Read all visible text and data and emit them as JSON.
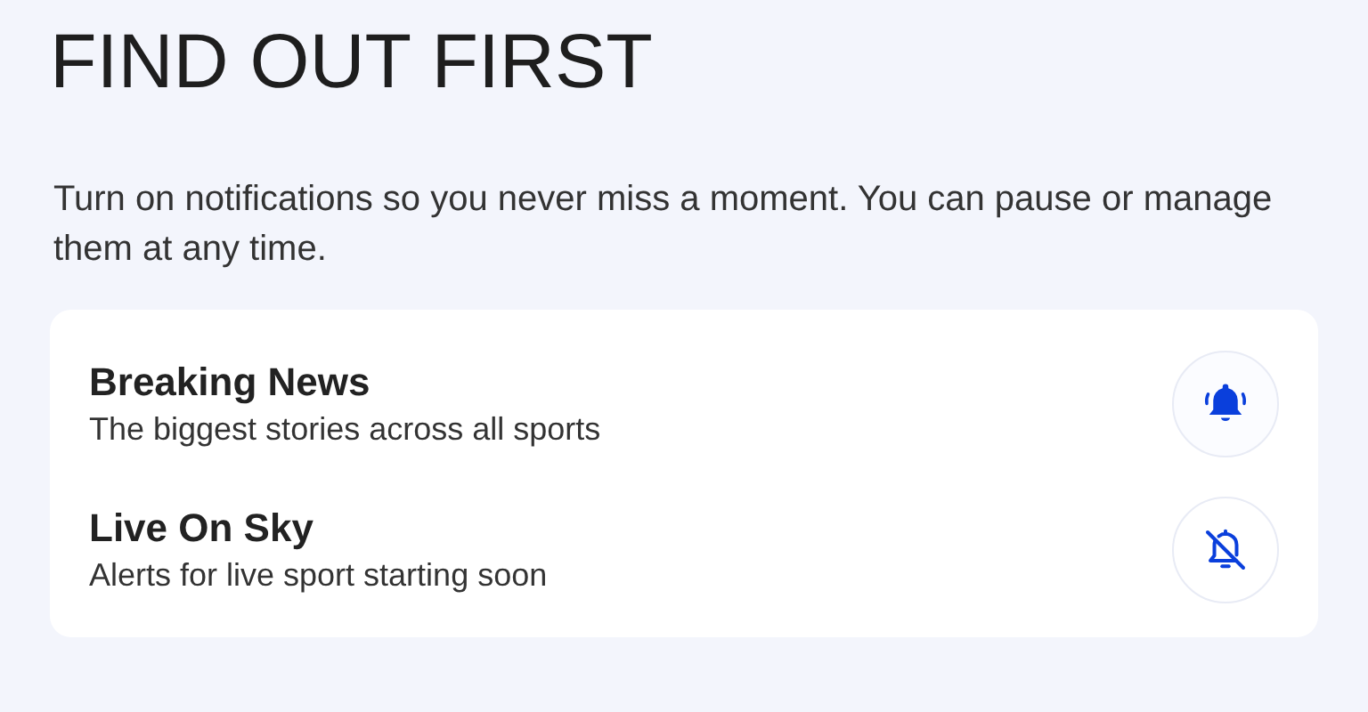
{
  "heading": "FIND OUT FIRST",
  "intro": "Turn on notifications so you never miss a moment. You can pause or manage them at any time.",
  "alerts": [
    {
      "title": "Breaking News",
      "description": "The biggest stories across all sports",
      "on": true
    },
    {
      "title": "Live On Sky",
      "description": "Alerts for live sport starting soon",
      "on": false
    }
  ]
}
